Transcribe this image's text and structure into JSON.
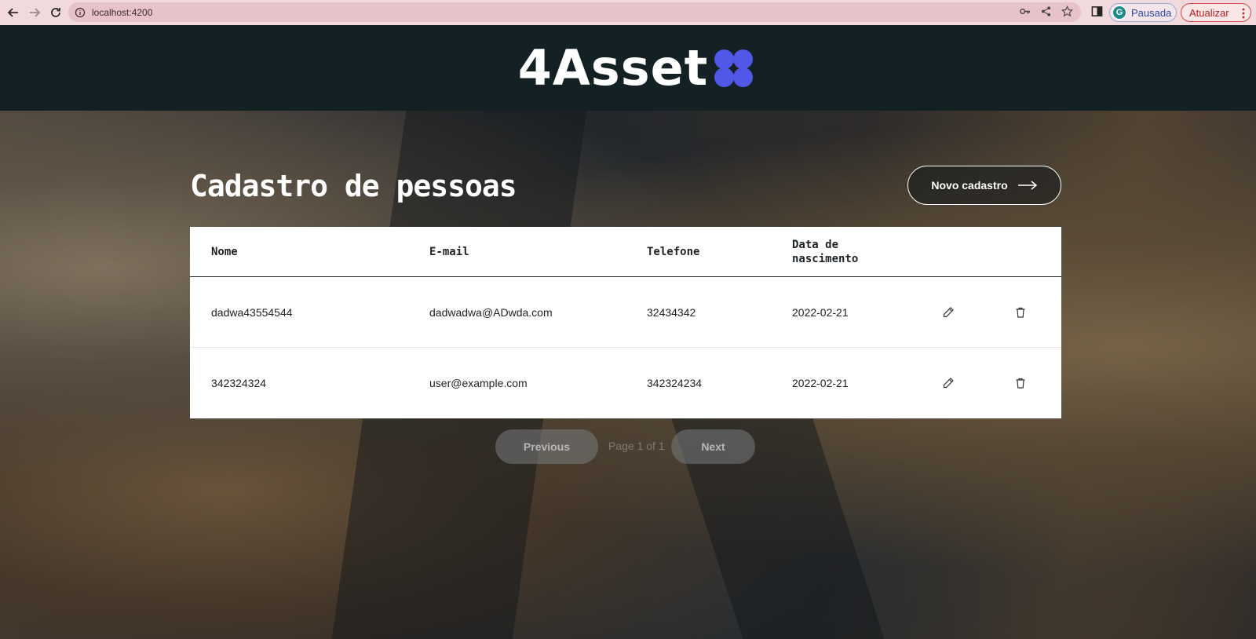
{
  "browser": {
    "url": "localhost:4200",
    "profile_label": "Pausada",
    "profile_initial": "G",
    "update_label": "Atualizar"
  },
  "header": {
    "logo_text": "4Asset"
  },
  "page": {
    "title": "Cadastro de pessoas",
    "new_button_label": "Novo cadastro"
  },
  "table": {
    "columns": [
      "Nome",
      "E-mail",
      "Telefone",
      "Data de nascimento"
    ],
    "rows": [
      {
        "nome": "dadwa43554544",
        "email": "dadwadwa@ADwda.com",
        "telefone": "32434342",
        "nascimento": "2022-02-21"
      },
      {
        "nome": "342324324",
        "email": "user@example.com",
        "telefone": "342324234",
        "nascimento": "2022-02-21"
      }
    ]
  },
  "pagination": {
    "previous_label": "Previous",
    "info": "Page 1 of 1",
    "next_label": "Next"
  },
  "colors": {
    "header_bg": "#132024",
    "logo_accent": "#5157e6",
    "chrome_bg": "#f1dadd"
  }
}
